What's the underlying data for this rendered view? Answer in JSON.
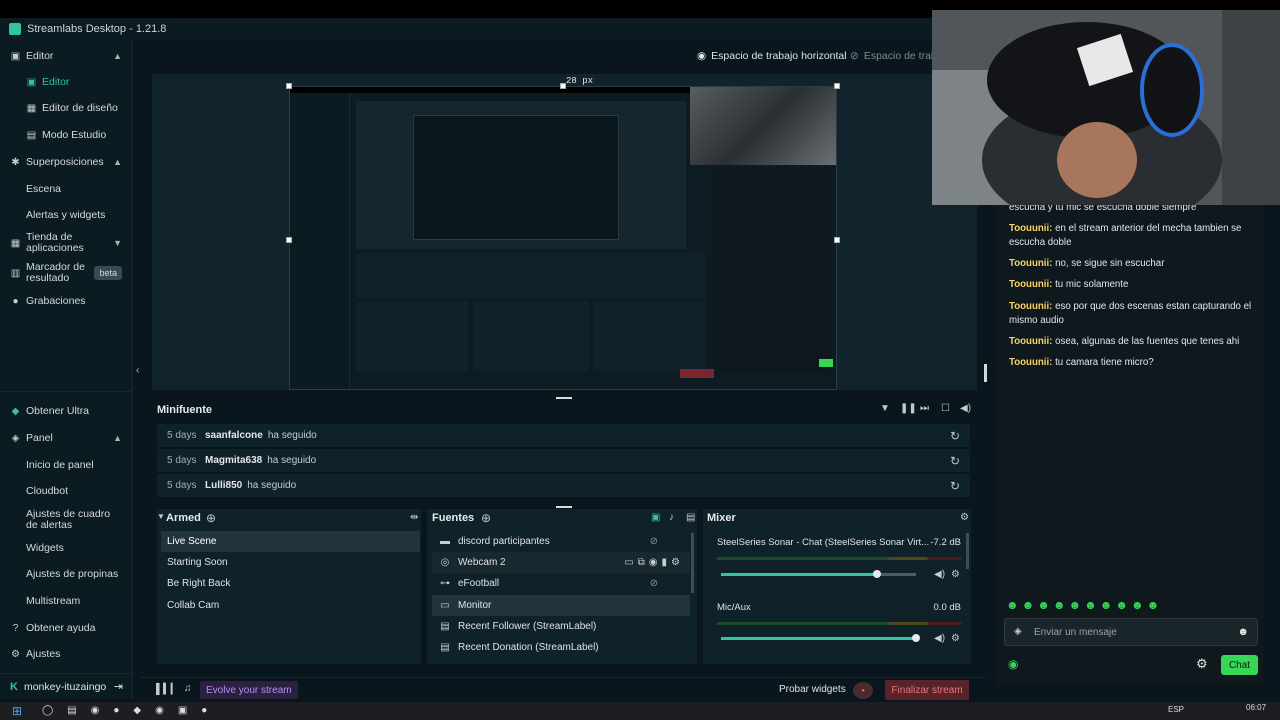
{
  "app": {
    "title": "Streamlabs Desktop - 1.21.8"
  },
  "sidebar": {
    "items": [
      {
        "label": "Editor",
        "icon": "editor-icon",
        "chevron": "up"
      },
      {
        "label": "Editor",
        "sub": true,
        "active": true,
        "icon": "editor-icon"
      },
      {
        "label": "Editor de diseño",
        "sub": true,
        "icon": "layout-icon"
      },
      {
        "label": "Modo Estudio",
        "sub": true,
        "icon": "studio-icon"
      },
      {
        "label": "Superposiciones",
        "icon": "overlays-icon",
        "chevron": "up"
      },
      {
        "label": "Escena",
        "sub": true
      },
      {
        "label": "Alertas y widgets",
        "sub": true
      },
      {
        "label": "Tienda de aplicaciones",
        "icon": "store-icon",
        "chevron": "down"
      },
      {
        "label": "Marcador de resultado",
        "icon": "scoreboard-icon",
        "badge": "beta"
      },
      {
        "label": "Grabaciones",
        "icon": "record-icon"
      }
    ],
    "bottom_items": [
      {
        "label": "Obtener Ultra",
        "icon": "ultra-icon"
      },
      {
        "label": "Panel",
        "icon": "panel-icon",
        "chevron": "up"
      },
      {
        "label": "Inicio de panel",
        "sub": true
      },
      {
        "label": "Cloudbot",
        "sub": true
      },
      {
        "label": "Ajustes de cuadro de alertas",
        "sub": true
      },
      {
        "label": "Widgets",
        "sub": true
      },
      {
        "label": "Ajustes de propinas",
        "sub": true
      },
      {
        "label": "Multistream",
        "sub": true
      },
      {
        "label": "Obtener ayuda",
        "icon": "help-icon"
      },
      {
        "label": "Ajustes",
        "icon": "settings-icon"
      }
    ],
    "user": "monkey-ituzaingo"
  },
  "workspace": {
    "horizontal": "Espacio de trabajo horizontal",
    "vertical": "Espacio de traba"
  },
  "preview": {
    "measure": "28 px"
  },
  "minifeed": {
    "title": "Minifuente",
    "events": [
      {
        "ago": "5 days",
        "who": "saanfalcone",
        "what": "ha seguido"
      },
      {
        "ago": "5 days",
        "who": "Magmita638",
        "what": "ha seguido"
      },
      {
        "ago": "5 days",
        "who": "Lulli850",
        "what": "ha seguido"
      }
    ]
  },
  "scenes": {
    "title": "Armed",
    "items": [
      "Live Scene",
      "Starting Soon",
      "Be Right Back",
      "Collab Cam"
    ],
    "selected": 0
  },
  "sources": {
    "title": "Fuentes",
    "items": [
      {
        "label": "discord participantes",
        "icon": "folder-icon"
      },
      {
        "label": "Webcam 2",
        "icon": "webcam-icon"
      },
      {
        "label": "eFootball",
        "icon": "gamepad-icon"
      },
      {
        "label": "Monitor",
        "icon": "monitor-icon"
      },
      {
        "label": "Recent Follower (StreamLabel)",
        "icon": "label-icon"
      },
      {
        "label": "Recent Donation (StreamLabel)",
        "icon": "label-icon"
      }
    ]
  },
  "mixer": {
    "title": "Mixer",
    "channels": [
      {
        "name": "SteelSeries Sonar - Chat (SteelSeries Sonar Virt...",
        "db": "-7.2 dB",
        "level": 0.8
      },
      {
        "name": "Mic/Aux",
        "db": "0.0 dB",
        "level": 1.0
      }
    ]
  },
  "footer": {
    "evolve": "Evolve your stream",
    "test_widgets": "Probar widgets",
    "end_stream": "Finalizar stream"
  },
  "chat": {
    "messages": [
      {
        "user": "",
        "text": "escucha y tu mic se escucha doble siempre"
      },
      {
        "user": "Toouunii:",
        "text": "en el stream anterior del mecha tambien se escucha doble"
      },
      {
        "user": "Toouunii:",
        "text": "no, se sigue sin escuchar"
      },
      {
        "user": "Toouunii:",
        "text": "tu mic solamente"
      },
      {
        "user": "Toouunii:",
        "text": "eso por que dos escenas estan capturando el mismo audio"
      },
      {
        "user": "Toouunii:",
        "text": "osea, algunas de las fuentes que tenes ahi"
      },
      {
        "user": "Toouunii:",
        "text": "tu camara tiene micro?"
      }
    ],
    "placeholder": "Enviar un mensaje",
    "send": "Chat"
  },
  "colors": {
    "accent": "#31c3a2",
    "danger": "#e05a5a",
    "chat_user": "#f6d364",
    "send": "#38d657"
  },
  "taskbar": {
    "lang": "ESP",
    "time": "06:07"
  }
}
